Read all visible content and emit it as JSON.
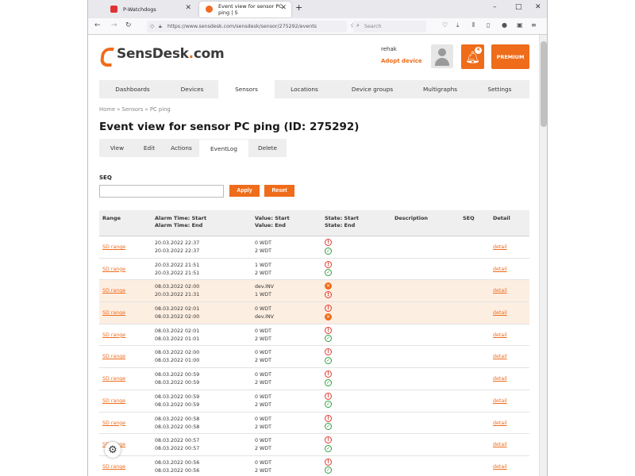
{
  "browser": {
    "tabs": [
      {
        "title": "P-Watchdogs"
      },
      {
        "title": "Event view for sensor PC ping | S"
      }
    ],
    "new_tab": "+",
    "window_controls": {
      "min": "–",
      "max": "□",
      "close": "✕"
    },
    "url": "https://www.sensdesk.com/sensdesk/sensor/275292/events",
    "search_placeholder": "Search"
  },
  "site": {
    "logo_text_a": "SensDesk",
    "logo_text_b": ".",
    "logo_text_c": "com",
    "user_name": "rehak",
    "adopt_device": "Adopt device",
    "bell_badge": "4",
    "premium_label": "PREMIUM"
  },
  "main_nav": [
    {
      "label": "Dashboards"
    },
    {
      "label": "Devices"
    },
    {
      "label": "Sensors",
      "active": true
    },
    {
      "label": "Locations"
    },
    {
      "label": "Device groups"
    },
    {
      "label": "Multigraphs"
    },
    {
      "label": "Settings"
    }
  ],
  "breadcrumb": "Home » Sensors » PC ping",
  "page_title": "Event view for sensor PC ping (ID: 275292)",
  "sub_tabs": [
    {
      "label": "View"
    },
    {
      "label": "Edit"
    },
    {
      "label": "Actions"
    },
    {
      "label": "EventLog",
      "active": true
    },
    {
      "label": "Delete"
    }
  ],
  "filter": {
    "seq_label": "SEQ",
    "seq_value": "",
    "apply_label": "Apply",
    "reset_label": "Reset"
  },
  "table": {
    "headers": {
      "range": "Range",
      "alarm_start": "Alarm Time: Start",
      "alarm_end": "Alarm Time: End",
      "value_start": "Value: Start",
      "value_end": "Value: End",
      "state_start": "State: Start",
      "state_end": "State: End",
      "description": "Description",
      "seq": "SEQ",
      "detail": "Detail"
    },
    "rows": [
      {
        "range": "SD range",
        "start": "20.03.2022 22:37",
        "end": "20.03.2022 22:37",
        "v_start": "0 WDT",
        "v_end": "2 WDT",
        "s_start": "alarm",
        "s_end": "ok",
        "detail": "detail",
        "highlight": false
      },
      {
        "range": "SD range",
        "start": "20.03.2022 21:51",
        "end": "20.03.2022 21:51",
        "v_start": "1 WDT",
        "v_end": "2 WDT",
        "s_start": "alarm",
        "s_end": "ok",
        "detail": "detail",
        "highlight": false
      },
      {
        "range": "SD range",
        "start": "08.03.2022 02:00",
        "end": "20.03.2022 21:31",
        "v_start": "dev.INV",
        "v_end": "1 WDT",
        "s_start": "off",
        "s_end": "alarm",
        "detail": "detail",
        "highlight": true
      },
      {
        "range": "SD range",
        "start": "08.03.2022 02:01",
        "end": "08.03.2022 02:00",
        "v_start": "0 WDT",
        "v_end": "dev.INV",
        "s_start": "alarm",
        "s_end": "off",
        "detail": "detail",
        "highlight": true
      },
      {
        "range": "SD range",
        "start": "08.03.2022 02:01",
        "end": "08.03.2022 01:01",
        "v_start": "0 WDT",
        "v_end": "2 WDT",
        "s_start": "alarm",
        "s_end": "ok",
        "detail": "detail",
        "highlight": false
      },
      {
        "range": "SD range",
        "start": "08.03.2022 02:00",
        "end": "08.03.2022 01:00",
        "v_start": "0 WDT",
        "v_end": "2 WDT",
        "s_start": "alarm",
        "s_end": "ok",
        "detail": "detail",
        "highlight": false
      },
      {
        "range": "SD range",
        "start": "08.03.2022 00:59",
        "end": "08.03.2022 00:59",
        "v_start": "0 WDT",
        "v_end": "2 WDT",
        "s_start": "alarm",
        "s_end": "ok",
        "detail": "detail",
        "highlight": false
      },
      {
        "range": "SD range",
        "start": "08.03.2022 00:59",
        "end": "08.03.2022 00:59",
        "v_start": "0 WDT",
        "v_end": "2 WDT",
        "s_start": "alarm",
        "s_end": "ok",
        "detail": "detail",
        "highlight": false
      },
      {
        "range": "SD range",
        "start": "08.03.2022 00:58",
        "end": "08.03.2022 00:58",
        "v_start": "0 WDT",
        "v_end": "2 WDT",
        "s_start": "alarm",
        "s_end": "ok",
        "detail": "detail",
        "highlight": false
      },
      {
        "range": "SD range",
        "start": "08.03.2022 00:57",
        "end": "08.03.2022 00:57",
        "v_start": "0 WDT",
        "v_end": "2 WDT",
        "s_start": "alarm",
        "s_end": "ok",
        "detail": "detail",
        "highlight": false
      },
      {
        "range": "SD range",
        "start": "08.03.2022 00:56",
        "end": "08.03.2022 00:56",
        "v_start": "0 WDT",
        "v_end": "2 WDT",
        "s_start": "alarm",
        "s_end": "ok",
        "detail": "detail",
        "highlight": false
      }
    ]
  },
  "icons": {
    "back": "back-arrow-icon",
    "forward": "forward-arrow-icon",
    "reload": "reload-icon",
    "bell": "bell-icon",
    "gear": "gear-icon",
    "alarm_state": "alarm-exclamation-icon",
    "ok_state": "ok-check-icon",
    "off_state": "invalid-x-icon"
  },
  "colors": {
    "accent": "#ef6c1a",
    "alarm": "#e03a2f",
    "ok": "#2e9e3f",
    "warn_row": "#fdeee2"
  }
}
